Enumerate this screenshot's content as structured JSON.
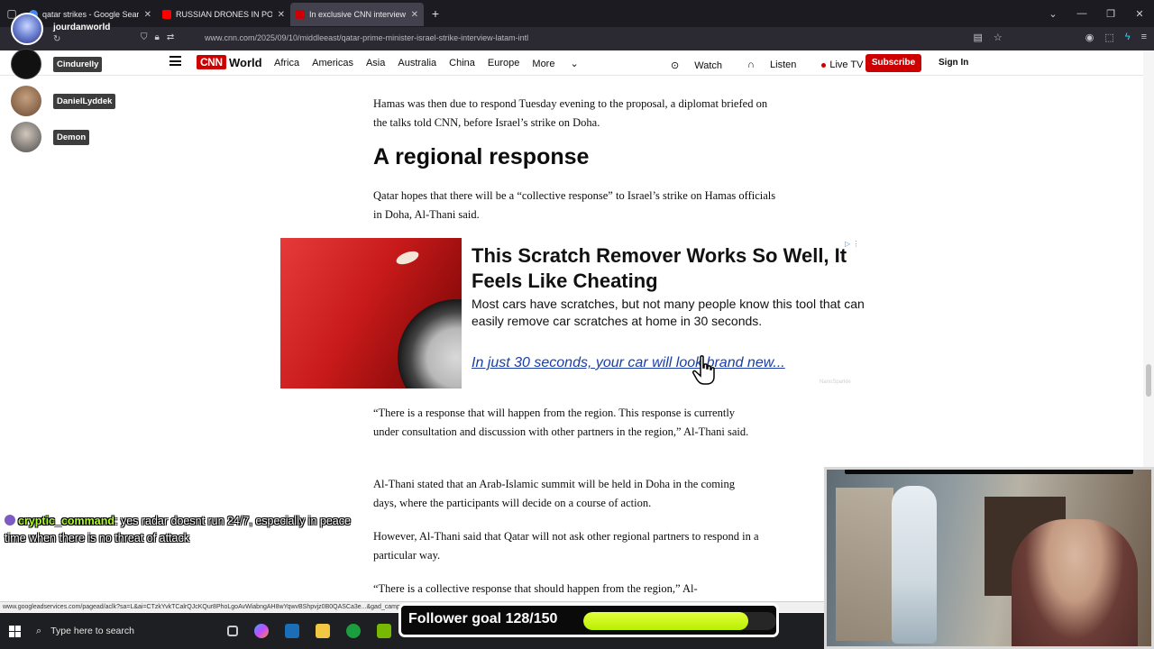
{
  "browser": {
    "tabs": [
      {
        "title": "qatar strikes - Google Search",
        "active": false,
        "color": "#4285f4"
      },
      {
        "title": "RUSSIAN DRONES IN POLAND",
        "active": false,
        "color": "#ff0000"
      },
      {
        "title": "In exclusive CNN interview, Qat",
        "active": true,
        "color": "#cc0000"
      }
    ],
    "url": "www.cnn.com/2025/09/10/middleeast/qatar-prime-minister-israel-strike-interview-latam-intl",
    "new_tab": "+"
  },
  "stream": {
    "channel": "jourdanworld",
    "viewers": [
      {
        "name": "Cindurelly"
      },
      {
        "name": "DanielLyddek"
      },
      {
        "name": "Demon"
      }
    ],
    "chat": {
      "user": "cryptic_command",
      "message": "yes radar doesnt run 24/7, especially in peace time when there is no threat of attack"
    },
    "goal": {
      "label": "Follower goal 128/150",
      "current": 128,
      "target": 150,
      "accent": "#c8f400"
    }
  },
  "cnn": {
    "logo": "CNN",
    "section": "World",
    "nav": [
      "Africa",
      "Americas",
      "Asia",
      "Australia",
      "China",
      "Europe",
      "More"
    ],
    "watch": "Watch",
    "listen": "Listen",
    "live": "Live TV",
    "subscribe": "Subscribe",
    "signin": "Sign In",
    "brand_color": "#cc0000"
  },
  "article": {
    "p1": "Hamas was then due to respond Tuesday evening to the proposal, a diplomat briefed on the talks told CNN, before Israel’s strike on Doha.",
    "heading": "A regional response",
    "p2": "Qatar hopes that there will be a “collective response” to Israel’s strike on Hamas officials in Doha, Al-Thani said.",
    "p3": "“There is a response that will happen from the region. This response is currently under consultation and discussion with other partners in the region,” Al-Thani said.",
    "p4": "Al-Thani stated that an Arab-Islamic summit will be held in Doha in the coming days, where the participants will decide on a course of action.",
    "p5": "However, Al-Thani said that Qatar will not ask other regional partners to respond in a particular way.",
    "p6": "“There is a collective response that should happen from the region,” Al-"
  },
  "ad": {
    "headline": "This Scratch Remover Works So Well, It Feels Like Cheating",
    "body": "Most cars have scratches, but not many people know this tool that can easily remove car scratches at home in 30 seconds.",
    "link": "In just 30 seconds, your car will look brand new...",
    "brand": "NanoSparkle"
  },
  "status_url": "www.googleadservices.com/pagead/aclk?sa=L&ai=CTzkYvkTCalrQJcKQur8PhoLgoAvWiabngAH8wYqwvBShpvjz0B0QASCa3e...&gad_campaig",
  "taskbar": {
    "search_placeholder": "Type here to search"
  }
}
